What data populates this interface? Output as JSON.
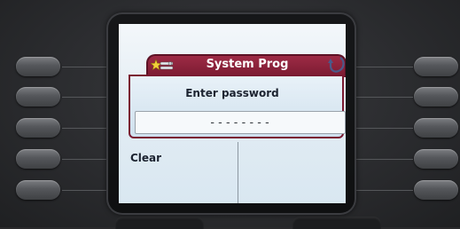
{
  "header": {
    "title": "System Prog",
    "icon": "settings-tools-icon",
    "back_icon": "back-arrow-icon"
  },
  "dialog": {
    "prompt": "Enter password",
    "password_mask": "--------"
  },
  "softkeys": {
    "left": [
      "Clear"
    ]
  },
  "colors": {
    "title_bar": "#8a2139",
    "screen_bg": "#e3edf4",
    "bezel": "#2a2a2c"
  }
}
